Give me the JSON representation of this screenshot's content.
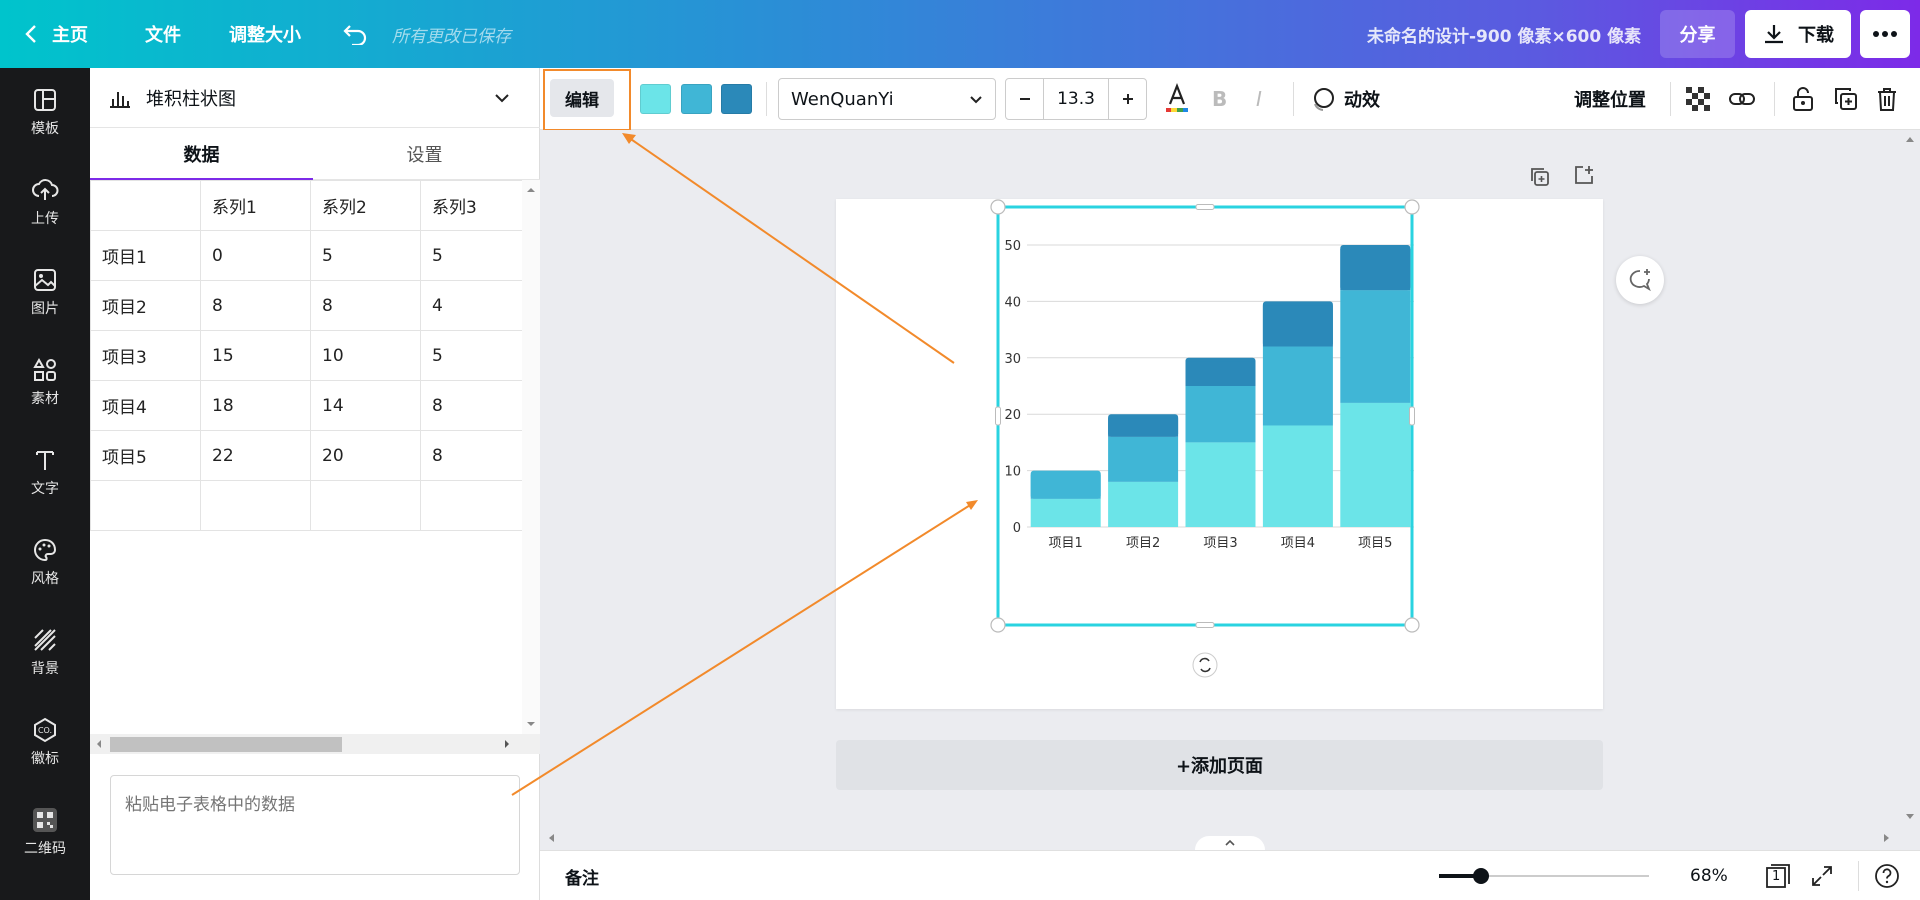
{
  "topbar": {
    "back_label": "主页",
    "file_label": "文件",
    "resize_label": "调整大小",
    "saved_status": "所有更改已保存",
    "design_title": "未命名的设计-900 像素×600 像素",
    "share_label": "分享",
    "download_label": "下载"
  },
  "rail": [
    {
      "label": "模板",
      "icon": "template-icon"
    },
    {
      "label": "上传",
      "icon": "upload-icon"
    },
    {
      "label": "图片",
      "icon": "image-icon"
    },
    {
      "label": "素材",
      "icon": "elements-icon"
    },
    {
      "label": "文字",
      "icon": "text-icon"
    },
    {
      "label": "风格",
      "icon": "palette-icon"
    },
    {
      "label": "背景",
      "icon": "background-icon"
    },
    {
      "label": "徽标",
      "icon": "logo-icon"
    },
    {
      "label": "二维码",
      "icon": "qrcode-icon"
    }
  ],
  "panel": {
    "chart_type": "堆积柱状图",
    "tab_data": "数据",
    "tab_settings": "设置",
    "columns": [
      "",
      "系列1",
      "系列2",
      "系列3"
    ],
    "rows": [
      [
        "项目1",
        "0",
        "5",
        "5"
      ],
      [
        "项目2",
        "8",
        "8",
        "4"
      ],
      [
        "项目3",
        "15",
        "10",
        "5"
      ],
      [
        "项目4",
        "18",
        "14",
        "8"
      ],
      [
        "项目5",
        "22",
        "20",
        "8"
      ],
      [
        "",
        "",
        "",
        ""
      ]
    ],
    "paste_placeholder": "粘贴电子表格中的数据"
  },
  "toolbar": {
    "edit_label": "编辑",
    "swatches": [
      "#6be4e8",
      "#40b6d6",
      "#2b89b9"
    ],
    "font_name": "WenQuanYi",
    "font_size": "13.3",
    "animate_label": "动效",
    "position_label": "调整位置"
  },
  "canvas": {
    "add_page_label": "+添加页面"
  },
  "bottombar": {
    "notes_label": "备注",
    "zoom_value": 0.2,
    "zoom_label": "68%",
    "page_count": "1"
  },
  "chart_data": {
    "type": "bar",
    "stacked": true,
    "categories": [
      "项目1",
      "项目2",
      "项目3",
      "项目4",
      "项目5"
    ],
    "series": [
      {
        "name": "系列1",
        "values": [
          5,
          8,
          15,
          18,
          22
        ],
        "color": "#6be4e8"
      },
      {
        "name": "系列2",
        "values": [
          5,
          8,
          10,
          14,
          20
        ],
        "color": "#40b6d6"
      },
      {
        "name": "系列3",
        "values": [
          0,
          4,
          5,
          8,
          8
        ],
        "color": "#2b89b9"
      }
    ],
    "ylim": [
      0,
      50
    ],
    "yticks": [
      "0",
      "10",
      "20",
      "30",
      "40",
      "50"
    ],
    "grid": true
  }
}
